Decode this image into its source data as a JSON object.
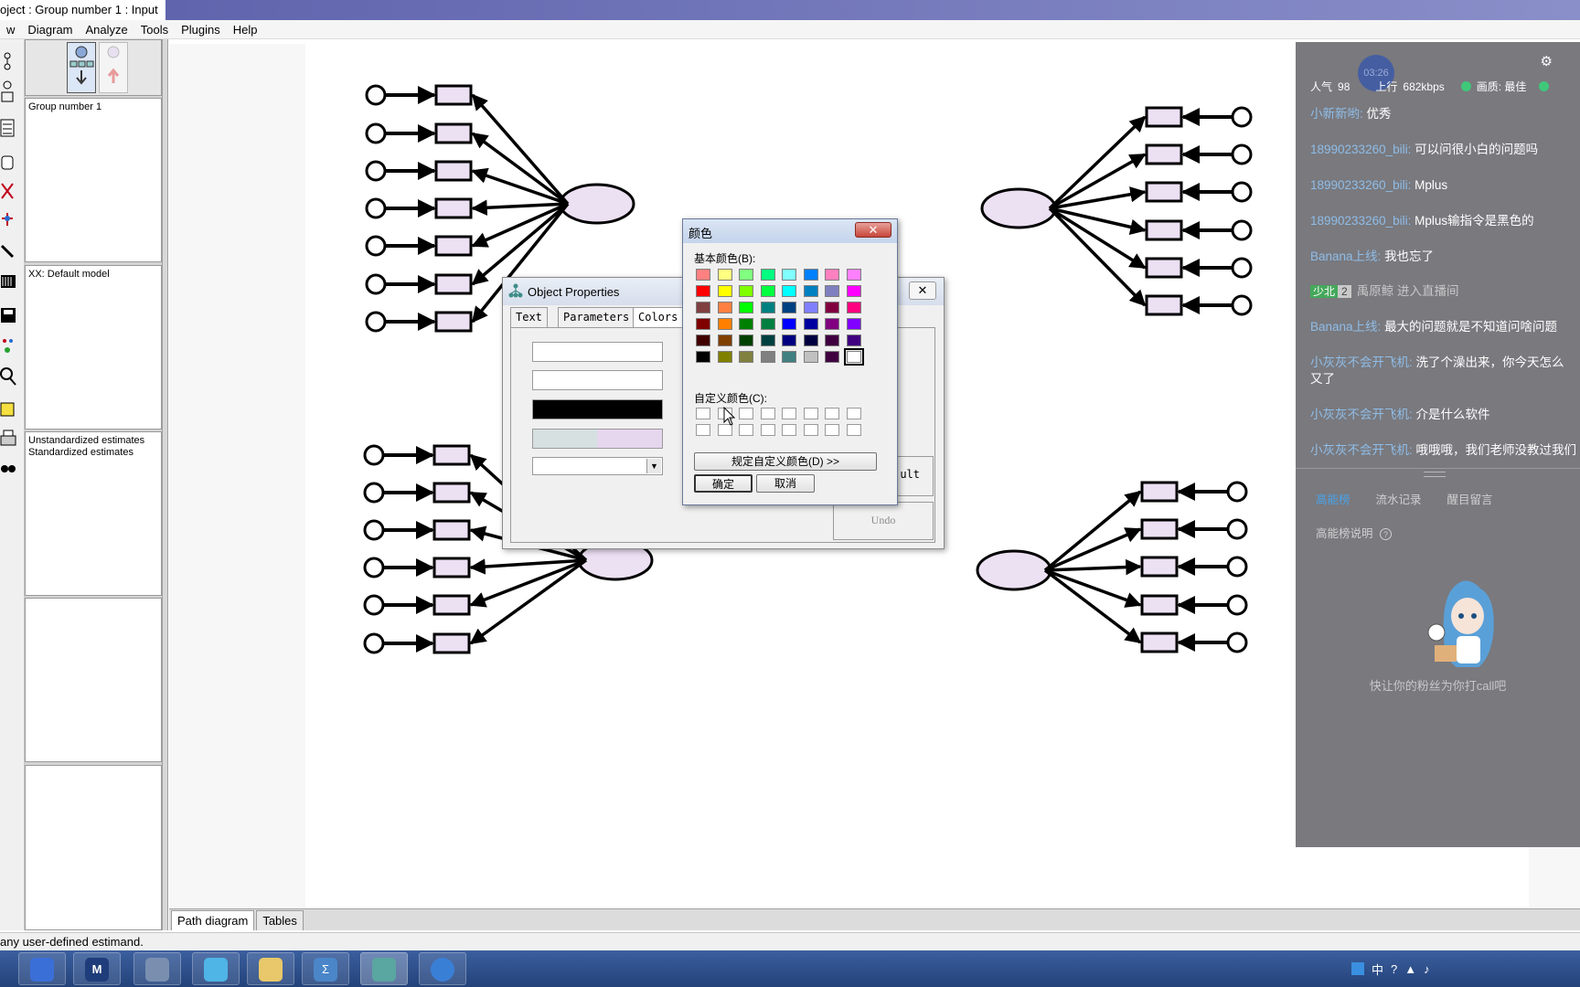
{
  "window": {
    "title": "oject : Group number 1 : Input"
  },
  "menu": [
    "w",
    "Diagram",
    "Analyze",
    "Tools",
    "Plugins",
    "Help"
  ],
  "panes": {
    "group": "Group number 1",
    "model": "XX: Default model",
    "estimates": [
      "Unstandardized estimates",
      "Standardized estimates"
    ]
  },
  "bottom_tabs": [
    "Path diagram",
    "Tables"
  ],
  "status": "any user-defined estimand.",
  "object_properties": {
    "title": "Object Properties",
    "tabs": [
      "Text",
      "Parameters",
      "Colors"
    ],
    "close": "✕",
    "buttons": {
      "default": "ult",
      "undo": "Undo"
    },
    "colors": {
      "line": "#000000",
      "fill_left": "#d6e0e0",
      "fill_right": "#e6d6ee"
    }
  },
  "color_dialog": {
    "title": "颜色",
    "close": "✕",
    "basic_label": "基本颜色(B):",
    "custom_label": "自定义颜色(C):",
    "define_button": "规定自定义颜色(D) >>",
    "ok": "确定",
    "cancel": "取消",
    "basic_colors": [
      [
        "#ff8080",
        "#ffff80",
        "#80ff80",
        "#00ff80",
        "#80ffff",
        "#0080ff",
        "#ff80c0",
        "#ff80ff"
      ],
      [
        "#ff0000",
        "#ffff00",
        "#80ff00",
        "#00ff40",
        "#00ffff",
        "#0080c0",
        "#8080c0",
        "#ff00ff"
      ],
      [
        "#804040",
        "#ff8040",
        "#00ff00",
        "#008080",
        "#004080",
        "#8080ff",
        "#800040",
        "#ff0080"
      ],
      [
        "#800000",
        "#ff8000",
        "#008000",
        "#008040",
        "#0000ff",
        "#0000a0",
        "#800080",
        "#8000ff"
      ],
      [
        "#400000",
        "#804000",
        "#004000",
        "#004040",
        "#000080",
        "#000040",
        "#400040",
        "#400080"
      ],
      [
        "#000000",
        "#808000",
        "#808040",
        "#808080",
        "#408080",
        "#c0c0c0",
        "#400040",
        "#ffffff"
      ]
    ]
  },
  "overlay": {
    "badge": "03:26",
    "popularity_label": "人气",
    "popularity": "98",
    "upload_label": "上行",
    "upload": "682kbps",
    "quality_label": "画质: 最佳",
    "chat": [
      {
        "user": "小新新哟:",
        "text": "优秀"
      },
      {
        "user": "18990233260_bili:",
        "text": "可以问很小白的问题吗"
      },
      {
        "user": "18990233260_bili:",
        "text": "Mplus"
      },
      {
        "user": "18990233260_bili:",
        "text": "Mplus输指令是黑色的"
      },
      {
        "user": "Banana上线:",
        "text": "我也忘了"
      },
      {
        "user": "少北",
        "level": "2",
        "user2": "禹原鲸",
        "text": "进入直播间"
      },
      {
        "user": "Banana上线:",
        "text": "最大的问题就是不知道问啥问题"
      },
      {
        "user": "小灰灰不会开飞机:",
        "text": "洗了个澡出来，你今天怎么又了"
      },
      {
        "user": "小灰灰不会开飞机:",
        "text": "介是什么软件"
      },
      {
        "user": "小灰灰不会开飞机:",
        "text": "哦哦哦，我们老师没教过我们"
      }
    ],
    "tabs": [
      "高能榜",
      "流水记录",
      "醒目留言"
    ],
    "rank_help": "高能榜说明",
    "call_text": "快让你的粉丝为你打call吧"
  },
  "tray": {
    "ime": "中"
  }
}
